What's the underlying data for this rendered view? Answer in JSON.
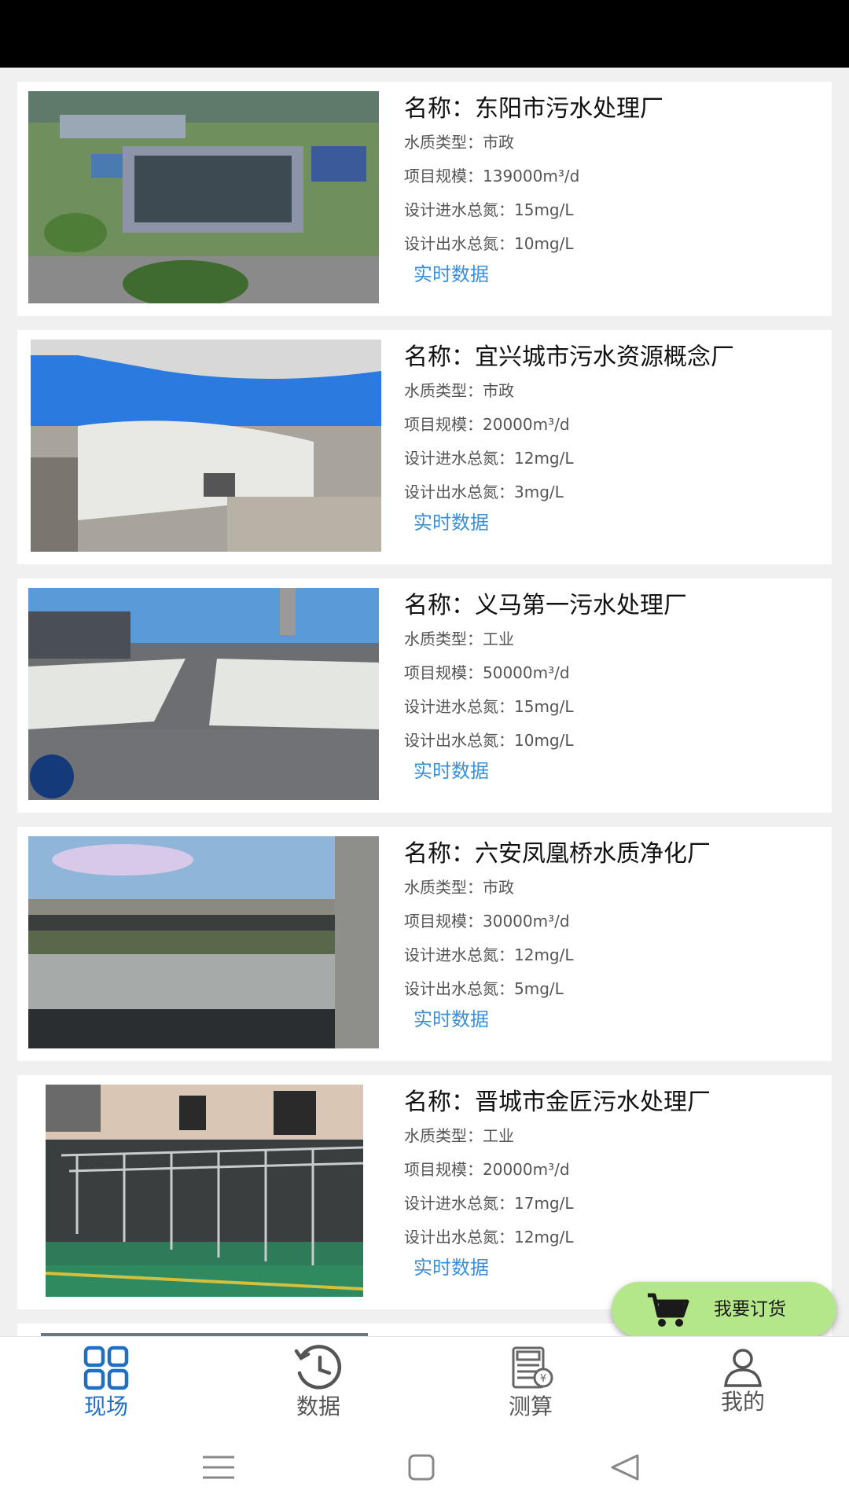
{
  "plants": [
    {
      "name": "名称：东阳市污水处理厂",
      "water_type": "水质类型：市政",
      "scale": "项目规模：139000m³/d",
      "inlet_tn": "设计进水总氮：15mg/L",
      "outlet_tn": "设计出水总氮：10mg/L",
      "link": "实时数据"
    },
    {
      "name": "名称：宜兴城市污水资源概念厂",
      "water_type": "水质类型：市政",
      "scale": "项目规模：20000m³/d",
      "inlet_tn": "设计进水总氮：12mg/L",
      "outlet_tn": "设计出水总氮：3mg/L",
      "link": "实时数据"
    },
    {
      "name": "名称：义马第一污水处理厂",
      "water_type": "水质类型：工业",
      "scale": "项目规模：50000m³/d",
      "inlet_tn": "设计进水总氮：15mg/L",
      "outlet_tn": "设计出水总氮：10mg/L",
      "link": "实时数据"
    },
    {
      "name": "名称：六安凤凰桥水质净化厂",
      "water_type": "水质类型：市政",
      "scale": "项目规模：30000m³/d",
      "inlet_tn": "设计进水总氮：12mg/L",
      "outlet_tn": "设计出水总氮：5mg/L",
      "link": "实时数据"
    },
    {
      "name": "名称：晋城市金匠污水处理厂",
      "water_type": "水质类型：工业",
      "scale": "项目规模：20000m³/d",
      "inlet_tn": "设计进水总氮：17mg/L",
      "outlet_tn": "设计出水总氮：12mg/L",
      "link": "实时数据"
    }
  ],
  "order_button": {
    "label": "我要订货",
    "icon": "cart-icon"
  },
  "tabs": [
    {
      "label": "现场",
      "icon": "grid-icon",
      "active": true
    },
    {
      "label": "数据",
      "icon": "history-clock-icon"
    },
    {
      "label": "测算",
      "icon": "calculator-icon"
    },
    {
      "label": "我的",
      "icon": "user-icon"
    }
  ],
  "colors": {
    "accent": "#1f6fc2",
    "link": "#3a8fd6",
    "order_button": "#b4e68a"
  }
}
